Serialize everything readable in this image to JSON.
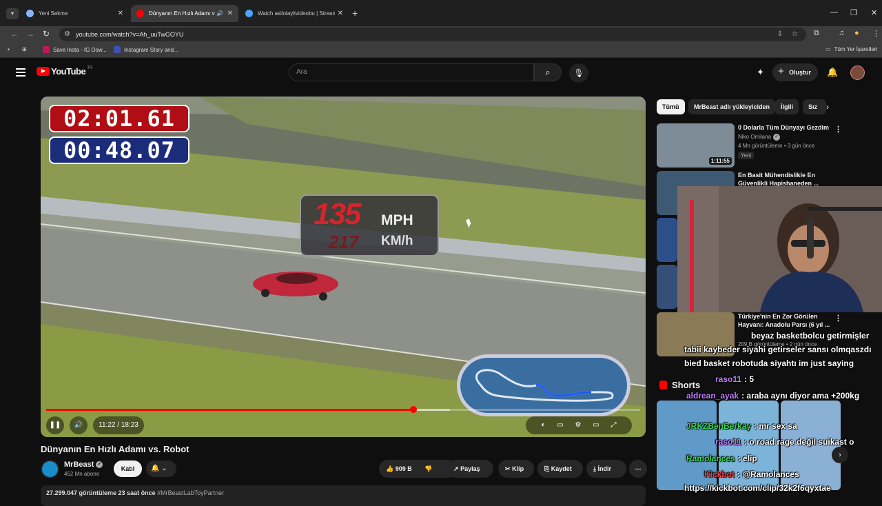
{
  "browser": {
    "tabs": [
      {
        "title": "Yeni Sekme",
        "favicon_color": "#8ab4f8"
      },
      {
        "title": "Dünyanın En Hızlı Adamı vs. ",
        "favicon_color": "#ff0000"
      },
      {
        "title": "Watch asilolaylivideobu | Stream",
        "favicon_color": "#4aa3ff"
      }
    ],
    "url": "youtube.com/watch?v=Ah_uuTwGOYU",
    "bookmarks": [
      {
        "label": "Save Insta - IG Dow...",
        "color": "#c2185b"
      },
      {
        "label": "Instagram Story and...",
        "color": "#3f51b5"
      }
    ],
    "all_bookmarks": "Tüm Yer İşaretleri"
  },
  "youtube": {
    "logo_text": "YouTube",
    "region": "TR",
    "search_placeholder": "Ara",
    "create_label": "Oluştur"
  },
  "video": {
    "overlay_time_total": "02:01.61",
    "overlay_time_lap": "00:48.07",
    "speed_mph": "135",
    "speed_mph_unit": "MPH",
    "speed_kmh": "217",
    "speed_kmh_unit": "KM/h",
    "time_display": "11:22 / 18:23",
    "progress_fraction": 0.618,
    "buffered_fraction": 0.68,
    "title": "Dünyanın En Hızlı Adamı vs. Robot",
    "channel": "MrBeast",
    "subscribers": "452 Mn abone",
    "join_label": "Katıl",
    "likes": "909 B",
    "share_label": "Paylaş",
    "clip_label": "Klip",
    "save_label": "Kaydet",
    "download_label": "İndir",
    "views_line": "27.299.047 görüntüleme  23 saat önce",
    "hashtags": "#MrBeastLabToyPartner"
  },
  "sidebar": {
    "chips": [
      "Tümü",
      "MrBeast adlı yükleyiciden",
      "İlgili",
      "Sız"
    ],
    "recommendations": [
      {
        "title": "0 Dolarla Tüm Dünyayı Gezdim",
        "channel": "Niko Omilana",
        "meta": "4 Mn görüntüleme • 3 gün önce",
        "badge": "Yeni",
        "duration": "1:11:55"
      },
      {
        "title": "En Basit Mühendislikle En Güvenlikli Hapishaneden ...",
        "channel": "",
        "meta": "",
        "badge": "",
        "duration": ""
      },
      {
        "title": "Türkiye'nin En Zor Görülen Hayvanı: Anadolu Parsı (6 yıl ...",
        "channel": "",
        "meta": "209 B görüntüleme • 2 gün önce",
        "badge": "Yeni",
        "duration": ""
      }
    ],
    "shorts_label": "Shorts"
  },
  "chat_overlay": [
    {
      "user": "",
      "text": "beyaz basketbolcu getirmişler"
    },
    {
      "user": "",
      "text": "tabii kaybeder siyahi getirseler sansı olmqaszdı"
    },
    {
      "user": "",
      "text": "bied basket robotuda siyahtı im just saying"
    },
    {
      "user": "raso11",
      "text": ": 5"
    },
    {
      "user": "aldrean_ayak",
      "text": ": araba aynı diyor ama +200kg"
    },
    {
      "user": "JRKZBenBerkay",
      "text": ": mr sex sa"
    },
    {
      "user": "raso11",
      "text": ": o road rage değil suikast o"
    },
    {
      "user": "Ramolances",
      "text": ": elip"
    },
    {
      "user": "Kickbot",
      "text": ": @Ramolances"
    },
    {
      "user": "",
      "text": "https://kickbot.com/clip/32k2f6qyxtae"
    }
  ]
}
